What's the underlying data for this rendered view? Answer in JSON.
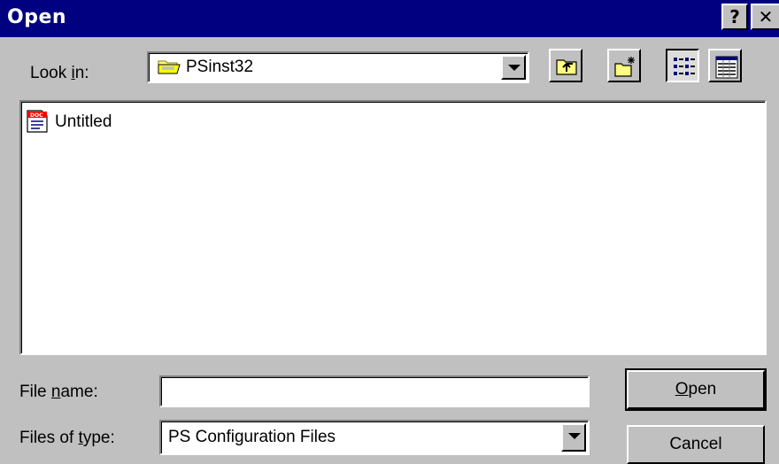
{
  "window": {
    "title": "Open",
    "help_label": "?",
    "close_label": "✕"
  },
  "look_in": {
    "label_pre": "Look ",
    "label_accel": "i",
    "label_post": "n:",
    "value": "PSinst32",
    "icon": "folder-icon"
  },
  "toolbar": {
    "up_one_level": "up-folder-icon",
    "create_new_folder": "new-folder-icon",
    "list_view": "list-view-icon",
    "details_view": "details-view-icon"
  },
  "files": [
    {
      "name": "Untitled",
      "icon": "doc-file-icon"
    }
  ],
  "file_name": {
    "label_pre": "File ",
    "label_accel": "n",
    "label_post": "ame:",
    "value": ""
  },
  "files_of_type": {
    "label_pre": "Files of ",
    "label_accel": "t",
    "label_post": "ype:",
    "value": "PS Configuration Files"
  },
  "buttons": {
    "open_accel": "O",
    "open_rest": "pen",
    "cancel": "Cancel"
  }
}
